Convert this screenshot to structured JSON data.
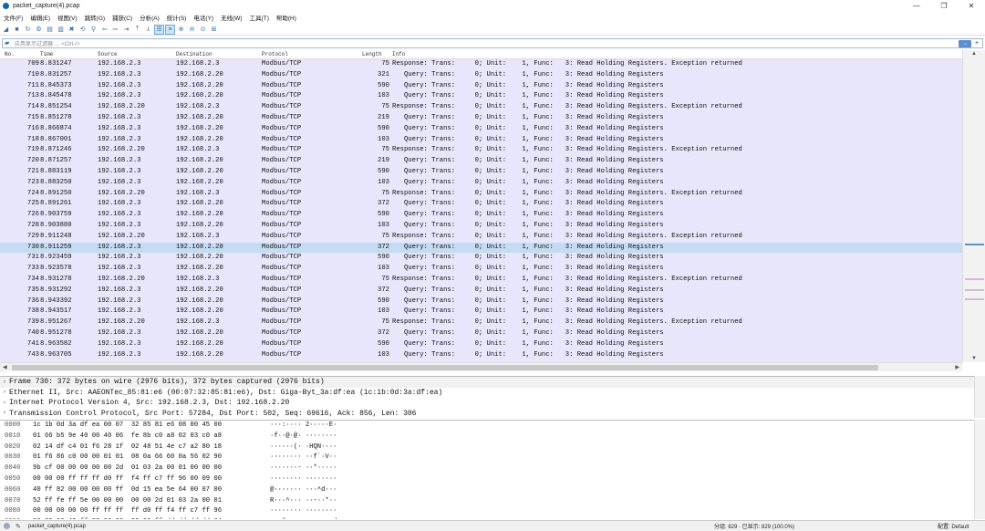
{
  "window": {
    "title": "packet_capture(4).pcap"
  },
  "menu": [
    "文件(F)",
    "编辑(E)",
    "视图(V)",
    "跳转(G)",
    "捕获(C)",
    "分析(A)",
    "统计(S)",
    "电话(Y)",
    "无线(W)",
    "工具(T)",
    "帮助(H)"
  ],
  "filter": {
    "placeholder": "应用显示过滤器 … <Ctrl-/>"
  },
  "columns": {
    "no": "No.",
    "time": "Time",
    "source": "Source",
    "destination": "Destination",
    "protocol": "Protocol",
    "length": "Length",
    "info": "Info"
  },
  "packets": [
    {
      "no": "709",
      "time": "8.831247",
      "src": "192.168.2.3",
      "dst": "192.168.2.3",
      "proto": "Modbus/TCP",
      "len": "75",
      "info": "Response: Trans:     0; Unit:    1, Func:   3: Read Holding Registers. Exception returned"
    },
    {
      "no": "710",
      "time": "8.831257",
      "src": "192.168.2.3",
      "dst": "192.168.2.20",
      "proto": "Modbus/TCP",
      "len": "321",
      "info": "   Query: Trans:     0; Unit:    1, Func:   3: Read Holding Registers"
    },
    {
      "no": "711",
      "time": "8.845373",
      "src": "192.168.2.3",
      "dst": "192.168.2.20",
      "proto": "Modbus/TCP",
      "len": "590",
      "info": "   Query: Trans:     0; Unit:    1, Func:   3: Read Holding Registers"
    },
    {
      "no": "713",
      "time": "8.845478",
      "src": "192.168.2.3",
      "dst": "192.168.2.20",
      "proto": "Modbus/TCP",
      "len": "103",
      "info": "   Query: Trans:     0; Unit:    1, Func:   3: Read Holding Registers"
    },
    {
      "no": "714",
      "time": "8.851254",
      "src": "192.168.2.20",
      "dst": "192.168.2.3",
      "proto": "Modbus/TCP",
      "len": "75",
      "info": "Response: Trans:     0; Unit:    1, Func:   3: Read Holding Registers. Exception returned"
    },
    {
      "no": "715",
      "time": "8.851278",
      "src": "192.168.2.3",
      "dst": "192.168.2.20",
      "proto": "Modbus/TCP",
      "len": "219",
      "info": "   Query: Trans:     0; Unit:    1, Func:   3: Read Holding Registers"
    },
    {
      "no": "716",
      "time": "8.866874",
      "src": "192.168.2.3",
      "dst": "192.168.2.20",
      "proto": "Modbus/TCP",
      "len": "590",
      "info": "   Query: Trans:     0; Unit:    1, Func:   3: Read Holding Registers"
    },
    {
      "no": "718",
      "time": "8.867001",
      "src": "192.168.2.3",
      "dst": "192.168.2.20",
      "proto": "Modbus/TCP",
      "len": "103",
      "info": "   Query: Trans:     0; Unit:    1, Func:   3: Read Holding Registers"
    },
    {
      "no": "719",
      "time": "8.871246",
      "src": "192.168.2.20",
      "dst": "192.168.2.3",
      "proto": "Modbus/TCP",
      "len": "75",
      "info": "Response: Trans:     0; Unit:    1, Func:   3: Read Holding Registers. Exception returned"
    },
    {
      "no": "720",
      "time": "8.871257",
      "src": "192.168.2.3",
      "dst": "192.168.2.20",
      "proto": "Modbus/TCP",
      "len": "219",
      "info": "   Query: Trans:     0; Unit:    1, Func:   3: Read Holding Registers"
    },
    {
      "no": "721",
      "time": "8.883119",
      "src": "192.168.2.3",
      "dst": "192.168.2.20",
      "proto": "Modbus/TCP",
      "len": "590",
      "info": "   Query: Trans:     0; Unit:    1, Func:   3: Read Holding Registers"
    },
    {
      "no": "723",
      "time": "8.883250",
      "src": "192.168.2.3",
      "dst": "192.168.2.20",
      "proto": "Modbus/TCP",
      "len": "103",
      "info": "   Query: Trans:     0; Unit:    1, Func:   3: Read Holding Registers"
    },
    {
      "no": "724",
      "time": "8.891250",
      "src": "192.168.2.20",
      "dst": "192.168.2.3",
      "proto": "Modbus/TCP",
      "len": "75",
      "info": "Response: Trans:     0; Unit:    1, Func:   3: Read Holding Registers. Exception returned"
    },
    {
      "no": "725",
      "time": "8.891261",
      "src": "192.168.2.3",
      "dst": "192.168.2.20",
      "proto": "Modbus/TCP",
      "len": "372",
      "info": "   Query: Trans:     0; Unit:    1, Func:   3: Read Holding Registers"
    },
    {
      "no": "726",
      "time": "8.903759",
      "src": "192.168.2.3",
      "dst": "192.168.2.20",
      "proto": "Modbus/TCP",
      "len": "590",
      "info": "   Query: Trans:     0; Unit:    1, Func:   3: Read Holding Registers"
    },
    {
      "no": "728",
      "time": "8.903880",
      "src": "192.168.2.3",
      "dst": "192.168.2.20",
      "proto": "Modbus/TCP",
      "len": "103",
      "info": "   Query: Trans:     0; Unit:    1, Func:   3: Read Holding Registers"
    },
    {
      "no": "729",
      "time": "8.911248",
      "src": "192.168.2.20",
      "dst": "192.168.2.3",
      "proto": "Modbus/TCP",
      "len": "75",
      "info": "Response: Trans:     0; Unit:    1, Func:   3: Read Holding Registers. Exception returned"
    },
    {
      "no": "730",
      "time": "8.911259",
      "src": "192.168.2.3",
      "dst": "192.168.2.20",
      "proto": "Modbus/TCP",
      "len": "372",
      "info": "   Query: Trans:     0; Unit:    1, Func:   3: Read Holding Registers",
      "selected": true
    },
    {
      "no": "731",
      "time": "8.923459",
      "src": "192.168.2.3",
      "dst": "192.168.2.20",
      "proto": "Modbus/TCP",
      "len": "590",
      "info": "   Query: Trans:     0; Unit:    1, Func:   3: Read Holding Registers"
    },
    {
      "no": "733",
      "time": "8.923578",
      "src": "192.168.2.3",
      "dst": "192.168.2.20",
      "proto": "Modbus/TCP",
      "len": "103",
      "info": "   Query: Trans:     0; Unit:    1, Func:   3: Read Holding Registers"
    },
    {
      "no": "734",
      "time": "8.931278",
      "src": "192.168.2.20",
      "dst": "192.168.2.3",
      "proto": "Modbus/TCP",
      "len": "75",
      "info": "Response: Trans:     0; Unit:    1, Func:   3: Read Holding Registers. Exception returned"
    },
    {
      "no": "735",
      "time": "8.931292",
      "src": "192.168.2.3",
      "dst": "192.168.2.20",
      "proto": "Modbus/TCP",
      "len": "372",
      "info": "   Query: Trans:     0; Unit:    1, Func:   3: Read Holding Registers"
    },
    {
      "no": "736",
      "time": "8.943392",
      "src": "192.168.2.3",
      "dst": "192.168.2.20",
      "proto": "Modbus/TCP",
      "len": "590",
      "info": "   Query: Trans:     0; Unit:    1, Func:   3: Read Holding Registers"
    },
    {
      "no": "738",
      "time": "8.943517",
      "src": "192.168.2.3",
      "dst": "192.168.2.20",
      "proto": "Modbus/TCP",
      "len": "103",
      "info": "   Query: Trans:     0; Unit:    1, Func:   3: Read Holding Registers"
    },
    {
      "no": "739",
      "time": "8.951267",
      "src": "192.168.2.20",
      "dst": "192.168.2.3",
      "proto": "Modbus/TCP",
      "len": "75",
      "info": "Response: Trans:     0; Unit:    1, Func:   3: Read Holding Registers. Exception returned"
    },
    {
      "no": "740",
      "time": "8.951278",
      "src": "192.168.2.3",
      "dst": "192.168.2.20",
      "proto": "Modbus/TCP",
      "len": "372",
      "info": "   Query: Trans:     0; Unit:    1, Func:   3: Read Holding Registers"
    },
    {
      "no": "741",
      "time": "8.963582",
      "src": "192.168.2.3",
      "dst": "192.168.2.20",
      "proto": "Modbus/TCP",
      "len": "590",
      "info": "   Query: Trans:     0; Unit:    1, Func:   3: Read Holding Registers"
    },
    {
      "no": "743",
      "time": "8.963705",
      "src": "192.168.2.3",
      "dst": "192.168.2.20",
      "proto": "Modbus/TCP",
      "len": "103",
      "info": "   Query: Trans:     0; Unit:    1, Func:   3: Read Holding Registers"
    }
  ],
  "details": [
    "Frame 730: 372 bytes on wire (2976 bits), 372 bytes captured (2976 bits)",
    "Ethernet II, Src: AAEONTec_85:81:e6 (00:07:32:85:81:e6), Dst: Giga-Byt_3a:df:ea (1c:1b:0d:3a:df:ea)",
    "Internet Protocol Version 4, Src: 192.168.2.3, Dst: 192.168.2.20",
    "Transmission Control Protocol, Src Port: 57284, Dst Port: 502, Seq: 69616, Ack: 856, Len: 306"
  ],
  "bytes": [
    {
      "off": "0000",
      "hex": "1c 1b 0d 3a df ea 00 07  32 85 81 e6 08 00 45 00",
      "ascii": "···:···· 2·····E·"
    },
    {
      "off": "0010",
      "hex": "01 66 b5 9e 40 00 40 06  fe 8b c0 a8 02 03 c0 a8",
      "ascii": "·f··@·@· ········"
    },
    {
      "off": "0020",
      "hex": "02 14 df c4 01 f6 28 1f  02 48 51 4e c7 a2 80 18",
      "ascii": "······(· ·HQN····"
    },
    {
      "off": "0030",
      "hex": "01 f6 86 c0 00 00 01 01  08 0a 66 60 0a 56 02 90",
      "ascii": "········ ··f`·V··"
    },
    {
      "off": "0040",
      "hex": "9b cf 00 00 00 00 00 2d  01 03 2a 00 01 00 00 00",
      "ascii": "·······- ··*·····"
    },
    {
      "off": "0050",
      "hex": "00 00 00 ff ff ff d0 ff  f4 ff c7 ff 96 00 09 00",
      "ascii": "········ ········"
    },
    {
      "off": "0060",
      "hex": "40 ff 82 00 00 00 00 ff  0d 15 ea 5e 64 00 07 00",
      "ascii": "@······· ···^d···"
    },
    {
      "off": "0070",
      "hex": "52 ff fe ff 5e 00 00 00  00 00 2d 01 03 2a 00 01",
      "ascii": "R···^··· ··-··*··"
    },
    {
      "off": "0080",
      "hex": "00 00 00 00 00 ff ff ff  ff d0 ff f4 ff c7 ff 96",
      "ascii": "········ ········"
    },
    {
      "off": "0090",
      "hex": "00 09 00 40 ff 82 00 00  00 00 ff dd dd dd dd 64",
      "ascii": "···@···· ·······d"
    }
  ],
  "status": {
    "file": "packet_capture(4).pcap",
    "stats": "分组: 829 · 已显示: 829 (100.0%)",
    "profile": "配置: Default"
  }
}
